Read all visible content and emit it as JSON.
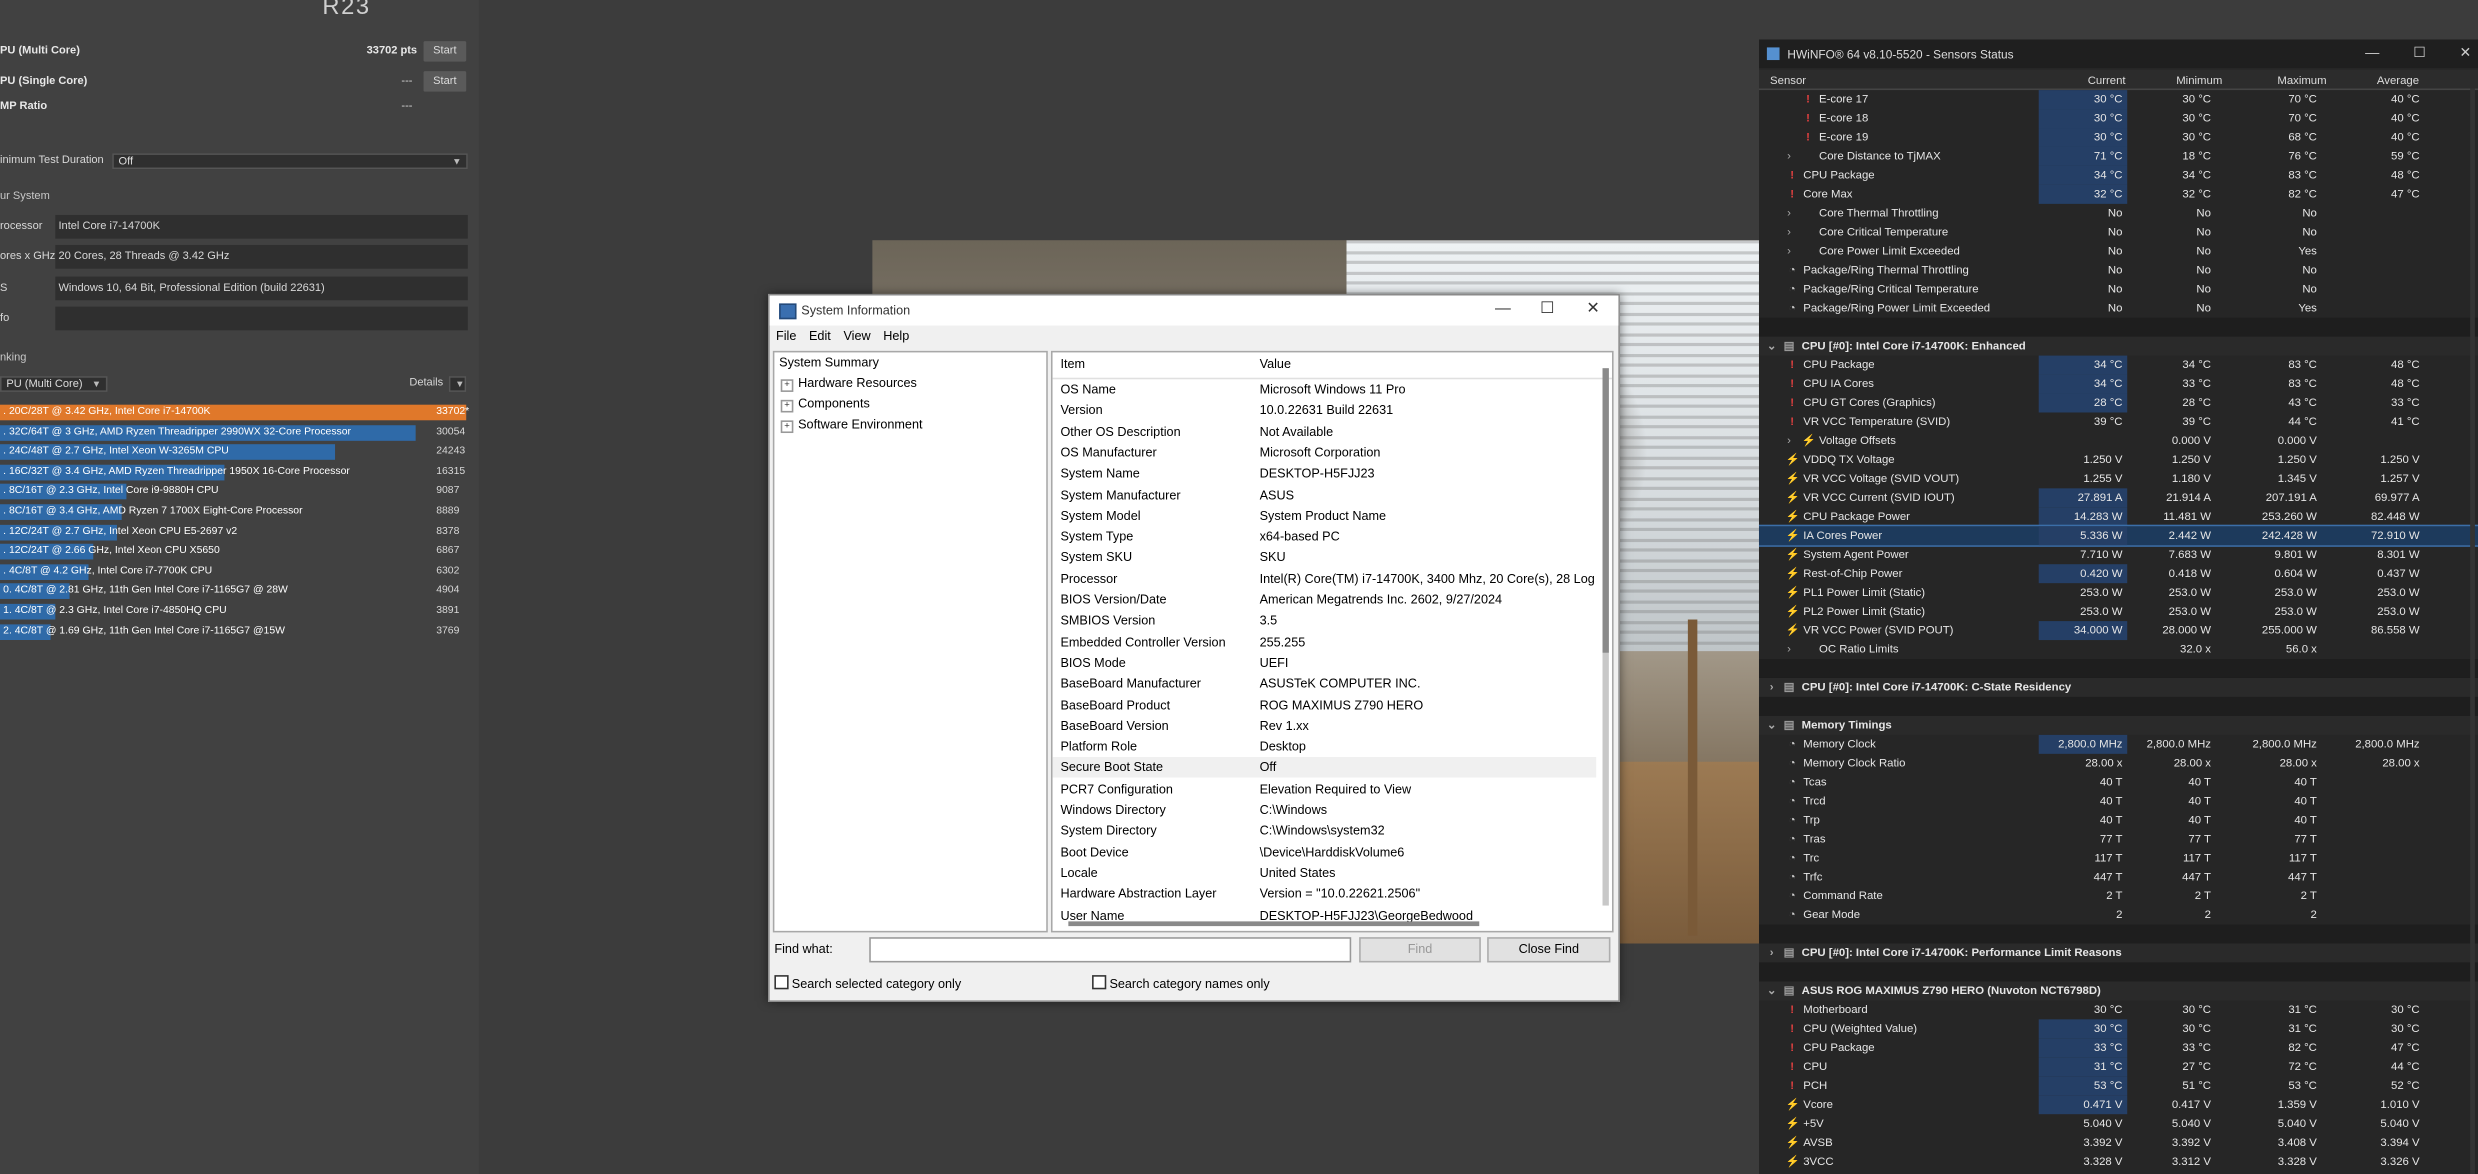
{
  "cinebench": {
    "logo": "R23",
    "multi_label": "PU (Multi Core)",
    "multi_score": "33702 pts",
    "single_label": "PU (Single Core)",
    "single_score": "---",
    "mp_label": "MP Ratio",
    "mp_value": "---",
    "start_label": "Start",
    "min_test_label": "inimum Test Duration",
    "min_test_value": "Off",
    "your_system": "ur System",
    "fields": [
      {
        "label": "rocessor",
        "value": "Intel Core i7-14700K"
      },
      {
        "label": "ores x GHz",
        "value": "20 Cores, 28 Threads @ 3.42 GHz"
      },
      {
        "label": "S",
        "value": "Windows 10, 64 Bit, Professional Edition (build 22631)"
      },
      {
        "label": "fo",
        "value": ""
      }
    ],
    "ranking": "nking",
    "rank_select": "PU (Multi Core)",
    "details": "Details",
    "ranks": [
      {
        "label": ". 20C/28T @ 3.42 GHz, Intel Core i7-14700K",
        "score": "33702*",
        "pct": 100,
        "color": "#e0782a"
      },
      {
        "label": ". 32C/64T @ 3 GHz, AMD Ryzen Threadripper 2990WX 32-Core Processor",
        "score": "30054",
        "pct": 89,
        "color": "#2f6aa8"
      },
      {
        "label": ". 24C/48T @ 2.7 GHz, Intel Xeon W-3265M CPU",
        "score": "24243",
        "pct": 72,
        "color": "#2f6aa8"
      },
      {
        "label": ". 16C/32T @ 3.4 GHz, AMD Ryzen Threadripper 1950X 16-Core Processor",
        "score": "16315",
        "pct": 48,
        "color": "#2f6aa8"
      },
      {
        "label": ". 8C/16T @ 2.3 GHz, Intel Core i9-9880H CPU",
        "score": "9087",
        "pct": 27,
        "color": "#2f6aa8"
      },
      {
        "label": ". 8C/16T @ 3.4 GHz, AMD Ryzen 7 1700X Eight-Core Processor",
        "score": "8889",
        "pct": 26,
        "color": "#2f6aa8"
      },
      {
        "label": ". 12C/24T @ 2.7 GHz, Intel Xeon CPU E5-2697 v2",
        "score": "8378",
        "pct": 25,
        "color": "#2f6aa8"
      },
      {
        "label": ". 12C/24T @ 2.66 GHz, Intel Xeon CPU X5650",
        "score": "6867",
        "pct": 20,
        "color": "#2f6aa8"
      },
      {
        "label": ". 4C/8T @ 4.2 GHz, Intel Core i7-7700K CPU",
        "score": "6302",
        "pct": 19,
        "color": "#2f6aa8"
      },
      {
        "label": "0. 4C/8T @ 2.81 GHz, 11th Gen Intel Core i7-1165G7 @ 28W",
        "score": "4904",
        "pct": 15,
        "color": "#2f6aa8"
      },
      {
        "label": "1. 4C/8T @ 2.3 GHz, Intel Core i7-4850HQ CPU",
        "score": "3891",
        "pct": 12,
        "color": "#2f6aa8"
      },
      {
        "label": "2. 4C/8T @ 1.69 GHz, 11th Gen Intel Core i7-1165G7 @15W",
        "score": "3769",
        "pct": 11,
        "color": "#2f6aa8"
      }
    ]
  },
  "sysinfo": {
    "title": "System Information",
    "menu": [
      "File",
      "Edit",
      "View",
      "Help"
    ],
    "tree": [
      "System Summary",
      "Hardware Resources",
      "Components",
      "Software Environment"
    ],
    "col_item": "Item",
    "col_value": "Value",
    "rows": [
      [
        "OS Name",
        "Microsoft Windows 11 Pro"
      ],
      [
        "Version",
        "10.0.22631 Build 22631"
      ],
      [
        "Other OS Description",
        "Not Available"
      ],
      [
        "OS Manufacturer",
        "Microsoft Corporation"
      ],
      [
        "System Name",
        "DESKTOP-H5FJJ23"
      ],
      [
        "System Manufacturer",
        "ASUS"
      ],
      [
        "System Model",
        "System Product Name"
      ],
      [
        "System Type",
        "x64-based PC"
      ],
      [
        "System SKU",
        "SKU"
      ],
      [
        "Processor",
        "Intel(R) Core(TM) i7-14700K, 3400 Mhz, 20 Core(s), 28 Logical Pro"
      ],
      [
        "BIOS Version/Date",
        "American Megatrends Inc. 2602, 9/27/2024"
      ],
      [
        "SMBIOS Version",
        "3.5"
      ],
      [
        "Embedded Controller Version",
        "255.255"
      ],
      [
        "BIOS Mode",
        "UEFI"
      ],
      [
        "BaseBoard Manufacturer",
        "ASUSTeK COMPUTER INC."
      ],
      [
        "BaseBoard Product",
        "ROG MAXIMUS Z790 HERO"
      ],
      [
        "BaseBoard Version",
        "Rev 1.xx"
      ],
      [
        "Platform Role",
        "Desktop"
      ],
      [
        "Secure Boot State",
        "Off"
      ],
      [
        "PCR7 Configuration",
        "Elevation Required to View"
      ],
      [
        "Windows Directory",
        "C:\\Windows"
      ],
      [
        "System Directory",
        "C:\\Windows\\system32"
      ],
      [
        "Boot Device",
        "\\Device\\HarddiskVolume6"
      ],
      [
        "Locale",
        "United States"
      ],
      [
        "Hardware Abstraction Layer",
        "Version = \"10.0.22621.2506\""
      ],
      [
        "User Name",
        "DESKTOP-H5FJJ23\\GeorgeBedwood"
      ]
    ],
    "find_label": "Find what:",
    "find_btn": "Find",
    "close_btn": "Close Find",
    "chk1": "Search selected category only",
    "chk2": "Search category names only"
  },
  "hwinfo": {
    "title": "HWiNFO® 64 v8.10-5520 - Sensors Status",
    "headers": [
      "Sensor",
      "Current",
      "Minimum",
      "Maximum",
      "Average"
    ],
    "rows": [
      {
        "t": "s",
        "i": "red",
        "n": "E-core 17",
        "v": [
          "30 °C",
          "30 °C",
          "70 °C",
          "40 °C"
        ],
        "ind": 2,
        "hl": 1
      },
      {
        "t": "s",
        "i": "red",
        "n": "E-core 18",
        "v": [
          "30 °C",
          "30 °C",
          "70 °C",
          "40 °C"
        ],
        "ind": 2,
        "hl": 1
      },
      {
        "t": "s",
        "i": "red",
        "n": "E-core 19",
        "v": [
          "30 °C",
          "30 °C",
          "68 °C",
          "40 °C"
        ],
        "ind": 2,
        "hl": 1
      },
      {
        "t": "s",
        "i": "arr",
        "n": "Core Distance to TjMAX",
        "v": [
          "71 °C",
          "18 °C",
          "76 °C",
          "59 °C"
        ],
        "ind": 2,
        "hl": 1,
        "exp": 1
      },
      {
        "t": "s",
        "i": "red",
        "n": "CPU Package",
        "v": [
          "34 °C",
          "34 °C",
          "83 °C",
          "48 °C"
        ],
        "ind": 1,
        "hl": 1
      },
      {
        "t": "s",
        "i": "red",
        "n": "Core Max",
        "v": [
          "32 °C",
          "32 °C",
          "82 °C",
          "47 °C"
        ],
        "ind": 1,
        "hl": 1
      },
      {
        "t": "s",
        "i": "arr",
        "n": "Core Thermal Throttling",
        "v": [
          "No",
          "No",
          "No",
          ""
        ],
        "ind": 2,
        "exp": 1
      },
      {
        "t": "s",
        "i": "arr",
        "n": "Core Critical Temperature",
        "v": [
          "No",
          "No",
          "No",
          ""
        ],
        "ind": 2,
        "exp": 1
      },
      {
        "t": "s",
        "i": "arr",
        "n": "Core Power Limit Exceeded",
        "v": [
          "No",
          "No",
          "Yes",
          ""
        ],
        "ind": 2,
        "exp": 1
      },
      {
        "t": "s",
        "i": "clk",
        "n": "Package/Ring Thermal Throttling",
        "v": [
          "No",
          "No",
          "No",
          ""
        ],
        "ind": 1
      },
      {
        "t": "s",
        "i": "clk",
        "n": "Package/Ring Critical Temperature",
        "v": [
          "No",
          "No",
          "No",
          ""
        ],
        "ind": 1
      },
      {
        "t": "s",
        "i": "clk",
        "n": "Package/Ring Power Limit Exceeded",
        "v": [
          "No",
          "No",
          "Yes",
          ""
        ],
        "ind": 1
      },
      {
        "t": "b"
      },
      {
        "t": "g",
        "n": "CPU [#0]: Intel Core i7-14700K: Enhanced"
      },
      {
        "t": "s",
        "i": "red",
        "n": "CPU Package",
        "v": [
          "34 °C",
          "34 °C",
          "83 °C",
          "48 °C"
        ],
        "ind": 1,
        "hl": 1
      },
      {
        "t": "s",
        "i": "red",
        "n": "CPU IA Cores",
        "v": [
          "34 °C",
          "33 °C",
          "83 °C",
          "48 °C"
        ],
        "ind": 1,
        "hl": 1
      },
      {
        "t": "s",
        "i": "red",
        "n": "CPU GT Cores (Graphics)",
        "v": [
          "28 °C",
          "28 °C",
          "43 °C",
          "33 °C"
        ],
        "ind": 1,
        "hl": 1
      },
      {
        "t": "s",
        "i": "red",
        "n": "VR VCC Temperature (SVID)",
        "v": [
          "39 °C",
          "39 °C",
          "44 °C",
          "41 °C"
        ],
        "ind": 1,
        "hl": 0
      },
      {
        "t": "s",
        "i": "yel",
        "n": "Voltage Offsets",
        "v": [
          "",
          "0.000 V",
          "0.000 V",
          ""
        ],
        "ind": 2,
        "exp": 1
      },
      {
        "t": "s",
        "i": "yel",
        "n": "VDDQ TX Voltage",
        "v": [
          "1.250 V",
          "1.250 V",
          "1.250 V",
          "1.250 V"
        ],
        "ind": 1
      },
      {
        "t": "s",
        "i": "yel",
        "n": "VR VCC Voltage (SVID VOUT)",
        "v": [
          "1.255 V",
          "1.180 V",
          "1.345 V",
          "1.257 V"
        ],
        "ind": 1
      },
      {
        "t": "s",
        "i": "yel",
        "n": "VR VCC Current (SVID IOUT)",
        "v": [
          "27.891 A",
          "21.914 A",
          "207.191 A",
          "69.977 A"
        ],
        "ind": 1,
        "hl": 1
      },
      {
        "t": "s",
        "i": "yel",
        "n": "CPU Package Power",
        "v": [
          "14.283 W",
          "11.481 W",
          "253.260 W",
          "82.448 W"
        ],
        "ind": 1,
        "hl": 1
      },
      {
        "t": "s",
        "i": "yel",
        "n": "IA Cores Power",
        "v": [
          "5.336 W",
          "2.442 W",
          "242.428 W",
          "72.910 W"
        ],
        "ind": 1,
        "hl": 1,
        "sel": 1
      },
      {
        "t": "s",
        "i": "yel",
        "n": "System Agent Power",
        "v": [
          "7.710 W",
          "7.683 W",
          "9.801 W",
          "8.301 W"
        ],
        "ind": 1
      },
      {
        "t": "s",
        "i": "yel",
        "n": "Rest-of-Chip Power",
        "v": [
          "0.420 W",
          "0.418 W",
          "0.604 W",
          "0.437 W"
        ],
        "ind": 1,
        "hl": 1
      },
      {
        "t": "s",
        "i": "yel",
        "n": "PL1 Power Limit (Static)",
        "v": [
          "253.0 W",
          "253.0 W",
          "253.0 W",
          "253.0 W"
        ],
        "ind": 1
      },
      {
        "t": "s",
        "i": "yel",
        "n": "PL2 Power Limit (Static)",
        "v": [
          "253.0 W",
          "253.0 W",
          "253.0 W",
          "253.0 W"
        ],
        "ind": 1
      },
      {
        "t": "s",
        "i": "yel",
        "n": "VR VCC Power (SVID POUT)",
        "v": [
          "34.000 W",
          "28.000 W",
          "255.000 W",
          "86.558 W"
        ],
        "ind": 1,
        "hl": 1
      },
      {
        "t": "s",
        "i": "arr",
        "n": "OC Ratio Limits",
        "v": [
          "",
          "32.0 x",
          "56.0 x",
          ""
        ],
        "ind": 2,
        "exp": 1
      },
      {
        "t": "b"
      },
      {
        "t": "g",
        "n": "CPU [#0]: Intel Core i7-14700K: C-State Residency",
        "col": 1
      },
      {
        "t": "b"
      },
      {
        "t": "g",
        "n": "Memory Timings"
      },
      {
        "t": "s",
        "i": "clk",
        "n": "Memory Clock",
        "v": [
          "2,800.0 MHz",
          "2,800.0 MHz",
          "2,800.0 MHz",
          "2,800.0 MHz"
        ],
        "ind": 1,
        "hl": 1
      },
      {
        "t": "s",
        "i": "clk",
        "n": "Memory Clock Ratio",
        "v": [
          "28.00 x",
          "28.00 x",
          "28.00 x",
          "28.00 x"
        ],
        "ind": 1
      },
      {
        "t": "s",
        "i": "clk",
        "n": "Tcas",
        "v": [
          "40 T",
          "40 T",
          "40 T",
          ""
        ],
        "ind": 1
      },
      {
        "t": "s",
        "i": "clk",
        "n": "Trcd",
        "v": [
          "40 T",
          "40 T",
          "40 T",
          ""
        ],
        "ind": 1
      },
      {
        "t": "s",
        "i": "clk",
        "n": "Trp",
        "v": [
          "40 T",
          "40 T",
          "40 T",
          ""
        ],
        "ind": 1
      },
      {
        "t": "s",
        "i": "clk",
        "n": "Tras",
        "v": [
          "77 T",
          "77 T",
          "77 T",
          ""
        ],
        "ind": 1
      },
      {
        "t": "s",
        "i": "clk",
        "n": "Trc",
        "v": [
          "117 T",
          "117 T",
          "117 T",
          ""
        ],
        "ind": 1
      },
      {
        "t": "s",
        "i": "clk",
        "n": "Trfc",
        "v": [
          "447 T",
          "447 T",
          "447 T",
          ""
        ],
        "ind": 1
      },
      {
        "t": "s",
        "i": "clk",
        "n": "Command Rate",
        "v": [
          "2 T",
          "2 T",
          "2 T",
          ""
        ],
        "ind": 1
      },
      {
        "t": "s",
        "i": "clk",
        "n": "Gear Mode",
        "v": [
          "2",
          "2",
          "2",
          ""
        ],
        "ind": 1
      },
      {
        "t": "b"
      },
      {
        "t": "g",
        "n": "CPU [#0]: Intel Core i7-14700K: Performance Limit Reasons",
        "col": 1
      },
      {
        "t": "b"
      },
      {
        "t": "g",
        "n": "ASUS ROG MAXIMUS Z790 HERO (Nuvoton NCT6798D)"
      },
      {
        "t": "s",
        "i": "red",
        "n": "Motherboard",
        "v": [
          "30 °C",
          "30 °C",
          "31 °C",
          "30 °C"
        ],
        "ind": 1
      },
      {
        "t": "s",
        "i": "red",
        "n": "CPU (Weighted Value)",
        "v": [
          "30 °C",
          "30 °C",
          "31 °C",
          "30 °C"
        ],
        "ind": 1,
        "hl": 1
      },
      {
        "t": "s",
        "i": "red",
        "n": "CPU Package",
        "v": [
          "33 °C",
          "33 °C",
          "82 °C",
          "47 °C"
        ],
        "ind": 1,
        "hl": 1
      },
      {
        "t": "s",
        "i": "red",
        "n": "CPU",
        "v": [
          "31 °C",
          "27 °C",
          "72 °C",
          "44 °C"
        ],
        "ind": 1,
        "hl": 1
      },
      {
        "t": "s",
        "i": "red",
        "n": "PCH",
        "v": [
          "53 °C",
          "51 °C",
          "53 °C",
          "52 °C"
        ],
        "ind": 1,
        "hl": 1
      },
      {
        "t": "s",
        "i": "yel",
        "n": "Vcore",
        "v": [
          "0.471 V",
          "0.417 V",
          "1.359 V",
          "1.010 V"
        ],
        "ind": 1,
        "hl": 1
      },
      {
        "t": "s",
        "i": "yel",
        "n": "+5V",
        "v": [
          "5.040 V",
          "5.040 V",
          "5.040 V",
          "5.040 V"
        ],
        "ind": 1
      },
      {
        "t": "s",
        "i": "yel",
        "n": "AVSB",
        "v": [
          "3.392 V",
          "3.392 V",
          "3.408 V",
          "3.394 V"
        ],
        "ind": 1
      },
      {
        "t": "s",
        "i": "yel",
        "n": "3VCC",
        "v": [
          "3.328 V",
          "3.312 V",
          "3.328 V",
          "3.326 V"
        ],
        "ind": 1
      }
    ]
  }
}
